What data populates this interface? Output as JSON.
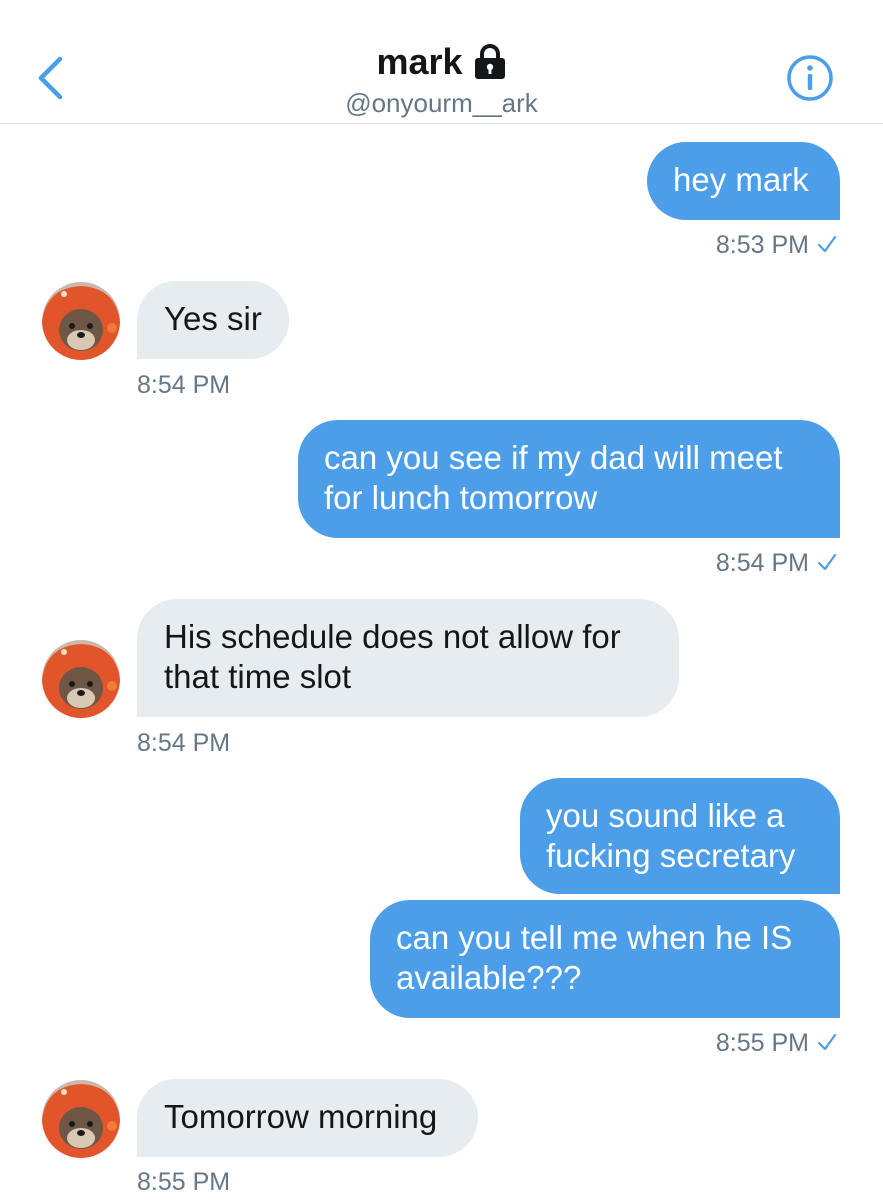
{
  "header": {
    "title": "mark",
    "handle": "@onyourm__ark",
    "back_icon": "chevron-left-icon",
    "lock_icon": "lock-icon",
    "info_icon": "info-icon",
    "accent_color": "#4c9ee8"
  },
  "messages": [
    {
      "direction": "outgoing",
      "text": "hey mark",
      "time": "8:53 PM"
    },
    {
      "direction": "incoming",
      "text": "Yes sir",
      "time": "8:54 PM"
    },
    {
      "direction": "outgoing",
      "text": "can you see if my dad will meet for lunch tomorrow",
      "time": "8:54 PM"
    },
    {
      "direction": "incoming",
      "text": "His schedule does not allow for that time slot",
      "time": "8:54 PM"
    },
    {
      "direction": "outgoing",
      "text": "you sound like a fucking secretary"
    },
    {
      "direction": "outgoing",
      "text": "can you tell me when he IS available???",
      "time": "8:55 PM"
    },
    {
      "direction": "incoming",
      "text": "Tomorrow morning",
      "time": "8:55 PM"
    }
  ],
  "colors": {
    "outgoing_bubble": "#4c9ee8",
    "incoming_bubble": "#e6ecf0",
    "timestamp": "#657786",
    "text_dark": "#14171a"
  }
}
